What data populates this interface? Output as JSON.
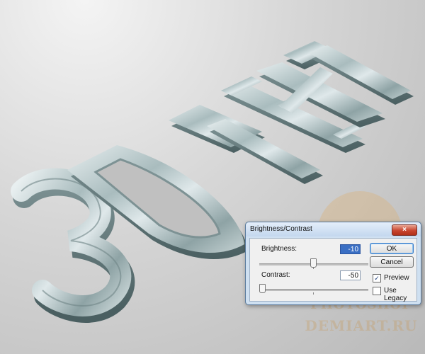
{
  "artwork": {
    "subject": "3D metallic extruded lettering on gradient background",
    "letters": [
      "3",
      "D",
      "T",
      "E",
      "X",
      "T"
    ],
    "colors": {
      "metal_light": "#dfe8ea",
      "metal_mid": "#9fb3b5",
      "metal_dark": "#4e6466",
      "side_dark": "#5f7575"
    }
  },
  "watermark": {
    "line1": "PHOTOSHOP",
    "line2": "DEMIART.RU",
    "color": "#d9a35a"
  },
  "dialog": {
    "title": "Brightness/Contrast",
    "close_icon": "close-icon",
    "brightness_label": "Brightness:",
    "brightness_value": "-10",
    "brightness_slider_fraction": 0.49,
    "contrast_label": "Contrast:",
    "contrast_value": "-50",
    "contrast_slider_fraction": 0.02,
    "ok_label": "OK",
    "cancel_label": "Cancel",
    "preview_label": "Preview",
    "preview_checked": true,
    "legacy_label": "Use Legacy",
    "legacy_checked": false,
    "check_mark": "✓"
  }
}
